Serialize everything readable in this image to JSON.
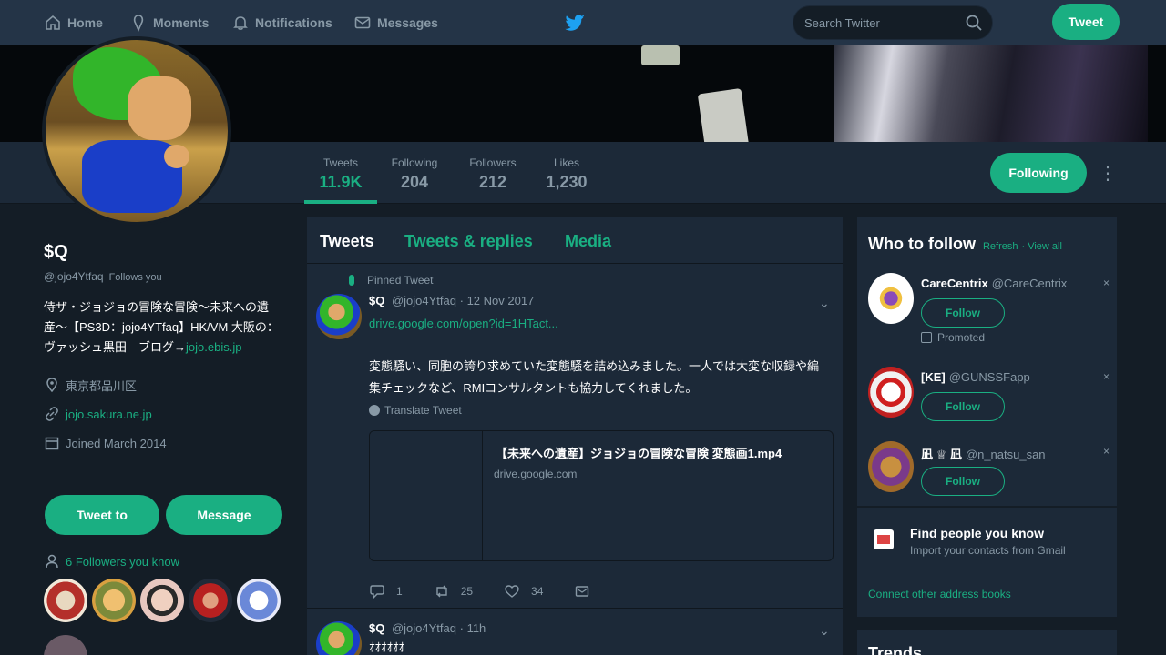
{
  "nav": {
    "home": "Home",
    "moments": "Moments",
    "notifications": "Notifications",
    "messages": "Messages",
    "search_placeholder": "Search Twitter",
    "tweet_button": "Tweet"
  },
  "profile_nav": {
    "stats": [
      {
        "label": "Tweets",
        "value": "11.9K"
      },
      {
        "label": "Following",
        "value": "204"
      },
      {
        "label": "Followers",
        "value": "212"
      },
      {
        "label": "Likes",
        "value": "1,230"
      }
    ],
    "following_button": "Following"
  },
  "profile": {
    "name": "$Q",
    "handle": "@jojo4Ytfaq",
    "follows_you": "Follows you",
    "bio": "侍ザ・ジョジョの冒険な冒険〜未来への遺産〜【PS3D：jojo4YTfaq】HK/VM 大阪の：ヴァッシュ黒田　ブログ→",
    "bio_link": "jojo.ebis.jp",
    "location": "東京都品川区",
    "website": "jojo.sakura.ne.jp",
    "joined": "Joined March 2014",
    "tweet_to": "Tweet to",
    "message": "Message",
    "followers_you_know": "6 Followers you know"
  },
  "timeline": {
    "tabs": [
      "Tweets",
      "Tweets & replies",
      "Media"
    ],
    "pinned_label": "Pinned Tweet",
    "tweet1": {
      "name": "$Q",
      "handle": "@jojo4Ytfaq",
      "date": "· 12 Nov 2017",
      "link": "drive.google.com/open?id=1HTact...",
      "body": "変態騒い、同胞の誇り求めていた変態騒を詰め込みました。一人では大変な収録や編集チェックなど、RMIコンサルタントも協力してくれました。",
      "translate": "Translate Tweet",
      "card_title": "【未来への遺産】ジョジョの冒険な冒険 変態画1.mp4",
      "card_domain": "drive.google.com",
      "replies": "1",
      "retweets": "25",
      "likes": "34"
    },
    "tweet2": {
      "name": "$Q",
      "handle": "@jojo4Ytfaq",
      "date": "· 11h",
      "body": "ｵｵｵｵｵｵ"
    }
  },
  "who_to_follow": {
    "title": "Who to follow",
    "refresh": "Refresh",
    "view_all": "· View all",
    "follow_label": "Follow",
    "promoted": "Promoted",
    "suggestions": [
      {
        "name": "CareCentrix",
        "handle": "@CareCentrix"
      },
      {
        "name": "[KE]",
        "handle": "@GUNSSFapp"
      },
      {
        "name": "凪 ♕ 凪",
        "handle": "@n_natsu_san"
      }
    ]
  },
  "find_people": {
    "title": "Find people you know",
    "subtitle": "Import your contacts from Gmail",
    "connect": "Connect other address books"
  },
  "trends": {
    "title": "Trends"
  },
  "colors": {
    "accent": "#1aaf82",
    "bg": "#141d26",
    "panel": "#1c2938",
    "nav": "#243447",
    "muted": "#8899a6"
  }
}
